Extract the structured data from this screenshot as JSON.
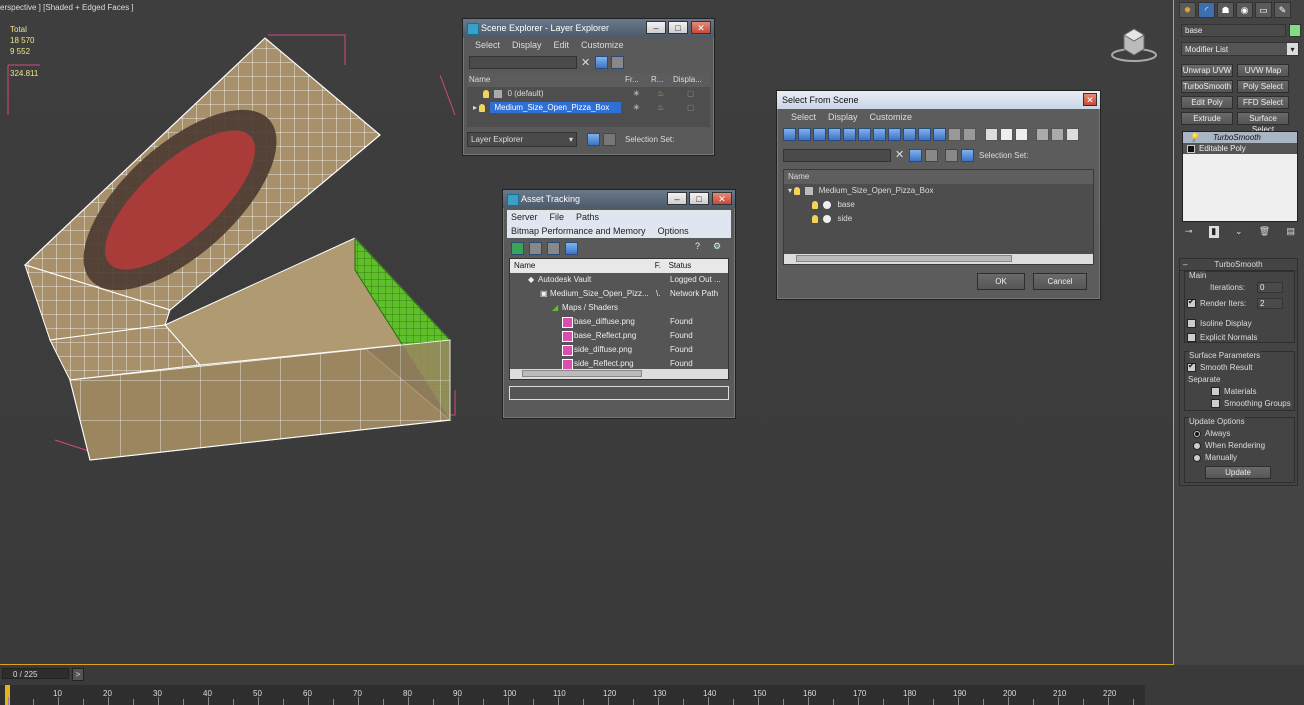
{
  "viewport": {
    "label": "erspective ] [Shaded + Edged Faces ]",
    "stats": [
      "Total",
      "18 570",
      "9 552",
      "",
      "324.811"
    ]
  },
  "scene_explorer": {
    "title": "Scene Explorer - Layer Explorer",
    "menu": [
      "Select",
      "Display",
      "Edit",
      "Customize"
    ],
    "columns": [
      "Name",
      "Fr...",
      "R...",
      "Displa..."
    ],
    "rows": [
      "0 (default)",
      "Medium_Size_Open_Pizza_Box"
    ],
    "footer_dropdown": "Layer Explorer",
    "footer_label": "Selection Set:"
  },
  "asset_tracking": {
    "title": "Asset Tracking",
    "menu": [
      "Server",
      "File",
      "Paths"
    ],
    "menu2": [
      "Bitmap Performance and Memory",
      "Options"
    ],
    "columns": [
      "Name",
      "F.",
      "Status"
    ],
    "rows": [
      {
        "name": "Autodesk Vault",
        "f": "",
        "status": "Logged Out ..."
      },
      {
        "name": "Medium_Size_Open_Pizz...",
        "f": "\\.",
        "status": "Network Path"
      },
      {
        "name": "Maps / Shaders",
        "f": "",
        "status": ""
      },
      {
        "name": "base_diffuse.png",
        "f": "",
        "status": "Found"
      },
      {
        "name": "base_Reflect.png",
        "f": "",
        "status": "Found"
      },
      {
        "name": "side_diffuse.png",
        "f": "",
        "status": "Found"
      },
      {
        "name": "side_Reflect.png",
        "f": "",
        "status": "Found"
      }
    ]
  },
  "select_from_scene": {
    "title": "Select From Scene",
    "menu": [
      "Select",
      "Display",
      "Customize"
    ],
    "selection_label": "Selection Set:",
    "column": "Name",
    "tree": [
      "Medium_Size_Open_Pizza_Box",
      "base",
      "side"
    ],
    "ok": "OK",
    "cancel": "Cancel"
  },
  "command_panel": {
    "object_name": "base",
    "modifier_list": "Modifier List",
    "buttons": [
      "Unwrap UVW",
      "UVW Map",
      "TurboSmooth",
      "Poly Select",
      "Edit Poly",
      "FFD Select",
      "Extrude",
      "Surface Select"
    ],
    "stack": [
      "TurboSmooth",
      "Editable Poly"
    ],
    "rollout_title": "TurboSmooth",
    "main_label": "Main",
    "iterations_label": "Iterations:",
    "iterations_value": "0",
    "render_iters_label": "Render Iters:",
    "render_iters_value": "2",
    "isoline": "Isoline Display",
    "explicit": "Explicit Normals",
    "surface_params": "Surface Parameters",
    "smooth_result": "Smooth Result",
    "separate": "Separate",
    "materials": "Materials",
    "smoothing_groups": "Smoothing Groups",
    "update_options": "Update Options",
    "always": "Always",
    "when_rendering": "When Rendering",
    "manually": "Manually",
    "update": "Update"
  },
  "timeline": {
    "frame": "0 / 225",
    "ticks": [
      "10",
      "20",
      "30",
      "40",
      "50",
      "60",
      "70",
      "80",
      "90",
      "100",
      "110",
      "120",
      "130",
      "140",
      "150",
      "160",
      "170",
      "180",
      "190",
      "200",
      "210",
      "220"
    ]
  },
  "colors": {
    "accent": "#e0a020",
    "selection": "#2f6fd6",
    "wire": "#ffffff",
    "box": "#a08a62",
    "green": "#5fbf2a"
  }
}
